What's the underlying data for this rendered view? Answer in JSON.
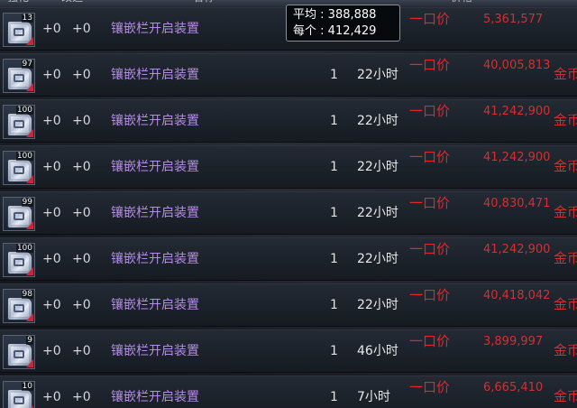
{
  "header": {
    "columns": [
      "强化",
      "改造",
      "名称",
      "",
      "价格",
      ""
    ]
  },
  "tooltip": {
    "avg_label": "平均",
    "avg_value": "388,888",
    "each_label": "每个",
    "each_value": "412,429"
  },
  "rows": [
    {
      "qty": "13",
      "enhance": "+0",
      "modify": "+0",
      "name": "镶嵌栏开启装置",
      "count": "",
      "time": "",
      "price_type": "一口价",
      "price": "5,361,577",
      "currency": ""
    },
    {
      "qty": "97",
      "enhance": "+0",
      "modify": "+0",
      "name": "镶嵌栏开启装置",
      "count": "1",
      "time": "22小时",
      "price_type": "一口价",
      "price": "40,005,813",
      "currency": "金币"
    },
    {
      "qty": "100",
      "enhance": "+0",
      "modify": "+0",
      "name": "镶嵌栏开启装置",
      "count": "1",
      "time": "22小时",
      "price_type": "一口价",
      "price": "41,242,900",
      "currency": "金币"
    },
    {
      "qty": "100",
      "enhance": "+0",
      "modify": "+0",
      "name": "镶嵌栏开启装置",
      "count": "1",
      "time": "22小时",
      "price_type": "一口价",
      "price": "41,242,900",
      "currency": "金币"
    },
    {
      "qty": "99",
      "enhance": "+0",
      "modify": "+0",
      "name": "镶嵌栏开启装置",
      "count": "1",
      "time": "22小时",
      "price_type": "一口价",
      "price": "40,830,471",
      "currency": "金币"
    },
    {
      "qty": "100",
      "enhance": "+0",
      "modify": "+0",
      "name": "镶嵌栏开启装置",
      "count": "1",
      "time": "22小时",
      "price_type": "一口价",
      "price": "41,242,900",
      "currency": "金币"
    },
    {
      "qty": "98",
      "enhance": "+0",
      "modify": "+0",
      "name": "镶嵌栏开启装置",
      "count": "1",
      "time": "22小时",
      "price_type": "一口价",
      "price": "40,418,042",
      "currency": "金币"
    },
    {
      "qty": "9",
      "enhance": "+0",
      "modify": "+0",
      "name": "镶嵌栏开启装置",
      "count": "1",
      "time": "46小时",
      "price_type": "一口价",
      "price": "3,899,997",
      "currency": "金币"
    },
    {
      "qty": "10",
      "enhance": "+0",
      "modify": "+0",
      "name": "镶嵌栏开启装置",
      "count": "1",
      "time": "7小时",
      "price_type": "一口价",
      "price": "6,665,410",
      "currency": "金币"
    }
  ]
}
